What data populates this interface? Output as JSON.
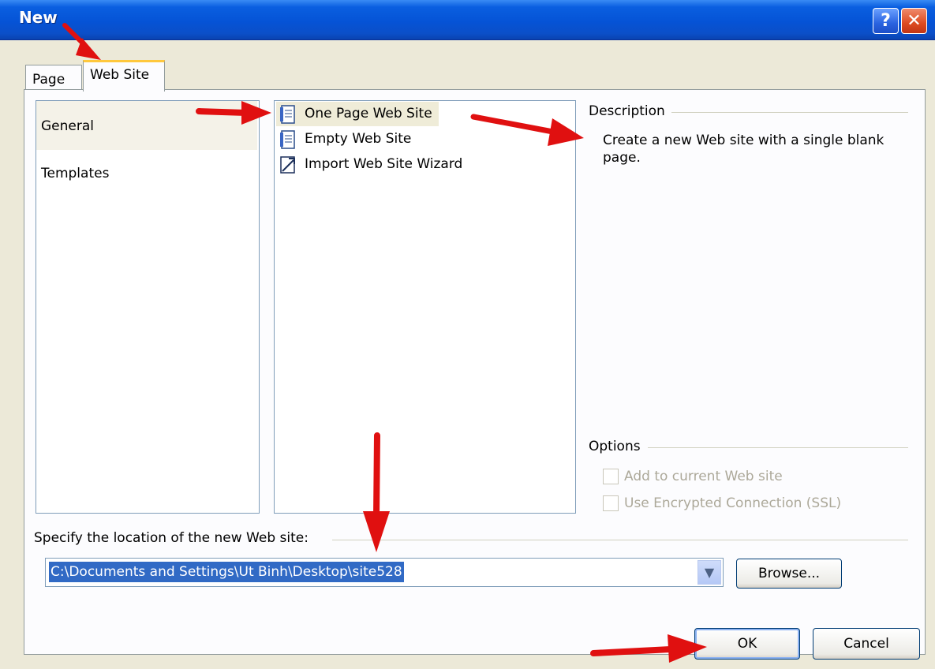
{
  "window": {
    "title": "New",
    "help_label": "?",
    "close_label": "✕"
  },
  "tabs": [
    {
      "label": "Page",
      "selected": false
    },
    {
      "label": "Web Site",
      "selected": true
    }
  ],
  "categories": [
    {
      "label": "General",
      "selected": true
    },
    {
      "label": "Templates",
      "selected": false
    }
  ],
  "templates": [
    {
      "label": "One Page Web Site",
      "icon": "page-template-icon",
      "selected": true
    },
    {
      "label": "Empty Web Site",
      "icon": "page-template-icon",
      "selected": false
    },
    {
      "label": "Import Web Site Wizard",
      "icon": "import-wizard-icon",
      "selected": false
    }
  ],
  "description": {
    "heading": "Description",
    "text": "Create a new Web site with a single blank page."
  },
  "options": {
    "heading": "Options",
    "add_to_current": {
      "label": "Add to current Web site",
      "checked": false,
      "enabled": false
    },
    "use_ssl": {
      "label": "Use Encrypted Connection (SSL)",
      "checked": false,
      "enabled": false
    }
  },
  "location": {
    "label": "Specify the location of the new Web site:",
    "value": "C:\\Documents and Settings\\Ut Binh\\Desktop\\site528",
    "browse_label": "Browse..."
  },
  "buttons": {
    "ok_label": "OK",
    "cancel_label": "Cancel"
  },
  "colors": {
    "annotation_arrow": "#e01010",
    "title_bar": "#0553d6",
    "selection": "#316ac5"
  }
}
